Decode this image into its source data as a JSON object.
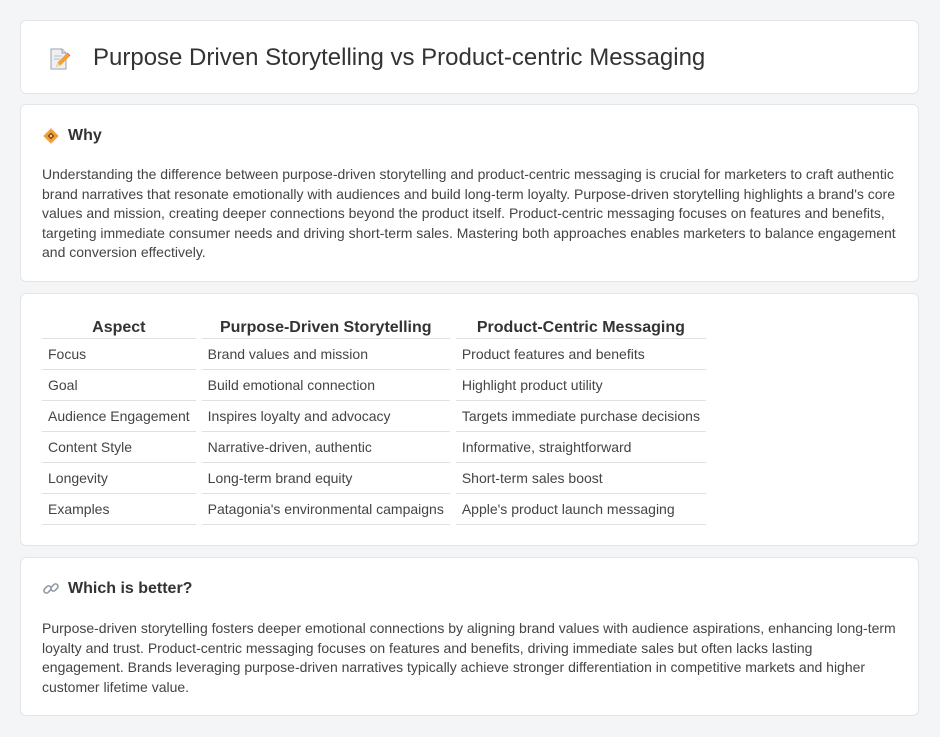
{
  "header": {
    "title": "Purpose Driven Storytelling vs Product-centric Messaging",
    "icon": "memo-pencil-icon"
  },
  "why": {
    "heading": "Why",
    "icon": "diamond-sparkle-icon",
    "text": "Understanding the difference between purpose-driven storytelling and product-centric messaging is crucial for marketers to craft authentic brand narratives that resonate emotionally with audiences and build long-term loyalty. Purpose-driven storytelling highlights a brand's core values and mission, creating deeper connections beyond the product itself. Product-centric messaging focuses on features and benefits, targeting immediate consumer needs and driving short-term sales. Mastering both approaches enables marketers to balance engagement and conversion effectively."
  },
  "comparison": {
    "headers": [
      "Aspect",
      "Purpose-Driven Storytelling",
      "Product-Centric Messaging"
    ],
    "rows": [
      [
        "Focus",
        "Brand values and mission",
        "Product features and benefits"
      ],
      [
        "Goal",
        "Build emotional connection",
        "Highlight product utility"
      ],
      [
        "Audience Engagement",
        "Inspires loyalty and advocacy",
        "Targets immediate purchase decisions"
      ],
      [
        "Content Style",
        "Narrative-driven, authentic",
        "Informative, straightforward"
      ],
      [
        "Longevity",
        "Long-term brand equity",
        "Short-term sales boost"
      ],
      [
        "Examples",
        "Patagonia's environmental campaigns",
        "Apple's product launch messaging"
      ]
    ]
  },
  "better": {
    "heading": "Which is better?",
    "icon": "link-icon",
    "text": "Purpose-driven storytelling fosters deeper emotional connections by aligning brand values with audience aspirations, enhancing long-term loyalty and trust. Product-centric messaging focuses on features and benefits, driving immediate sales but often lacks lasting engagement. Brands leveraging purpose-driven narratives typically achieve stronger differentiation in competitive markets and higher customer lifetime value."
  },
  "colors": {
    "background": "#f4f5f7",
    "card": "#ffffff",
    "accent_orange": "#f0a23a",
    "accent_pink": "#e86a7a"
  }
}
